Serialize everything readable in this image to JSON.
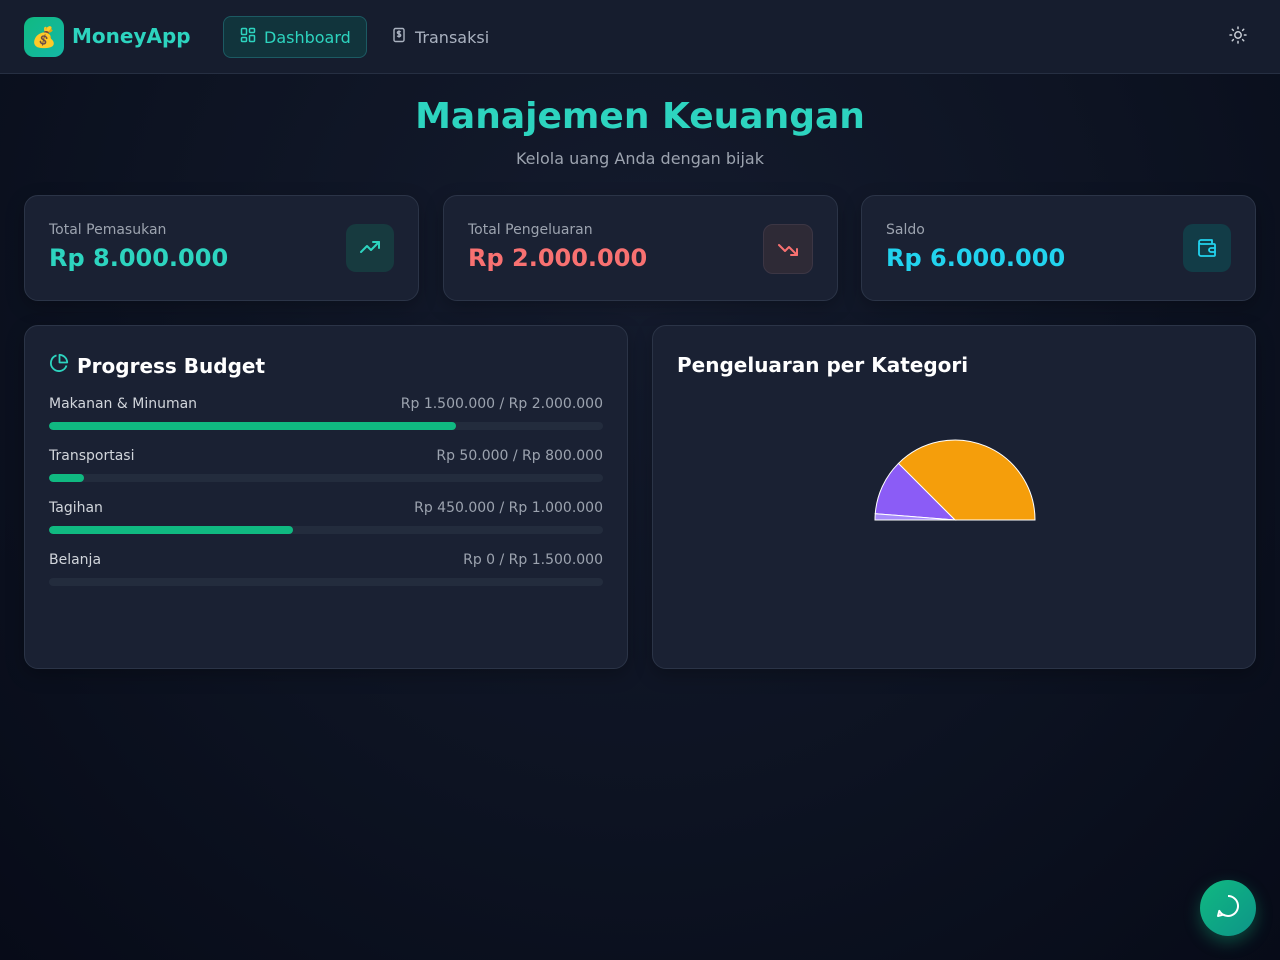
{
  "app": {
    "name": "MoneyApp",
    "logo_emoji": "💰"
  },
  "nav": {
    "dashboard_label": "Dashboard",
    "transaksi_label": "Transaksi",
    "theme_icon": "sun-icon"
  },
  "hero": {
    "title": "Manajemen Keuangan",
    "subtitle": "Kelola uang Anda dengan bijak"
  },
  "stats": [
    {
      "label": "Total Pemasukan",
      "value": "Rp 8.000.000",
      "color": "#2dd4bf",
      "icon": "trending-up-icon"
    },
    {
      "label": "Total Pengeluaran",
      "value": "Rp 2.000.000",
      "color": "#f87171",
      "icon": "trending-down-icon"
    },
    {
      "label": "Saldo",
      "value": "Rp 6.000.000",
      "color": "#22d3ee",
      "icon": "wallet-icon"
    }
  ],
  "budget": {
    "title": "Progress Budget",
    "items": [
      {
        "name": "Makanan & Minuman",
        "amount": "Rp 1.500.000 / Rp 2.000.000",
        "ratio": 0.735
      },
      {
        "name": "Transportasi",
        "amount": "Rp 50.000 / Rp 800.000",
        "ratio": 0.0625
      },
      {
        "name": "Tagihan",
        "amount": "Rp 450.000 / Rp 1.000.000",
        "ratio": 0.44
      },
      {
        "name": "Belanja",
        "amount": "Rp 0 / Rp 1.500.000",
        "ratio": 0
      }
    ]
  },
  "category_chart": {
    "title": "Pengeluaran per Kategori"
  },
  "chart_data": {
    "type": "pie",
    "values": [
      1500000,
      450000,
      50000
    ],
    "colors": [
      "#f59e0b",
      "#8b5cf6",
      "#a78bfa"
    ]
  },
  "chat": {
    "icon": "chat-icon"
  },
  "colors": {
    "accent": "#2dd4bf",
    "progress": "#10b981",
    "income": "#2dd4bf",
    "expense": "#f87171",
    "balance": "#22d3ee"
  }
}
